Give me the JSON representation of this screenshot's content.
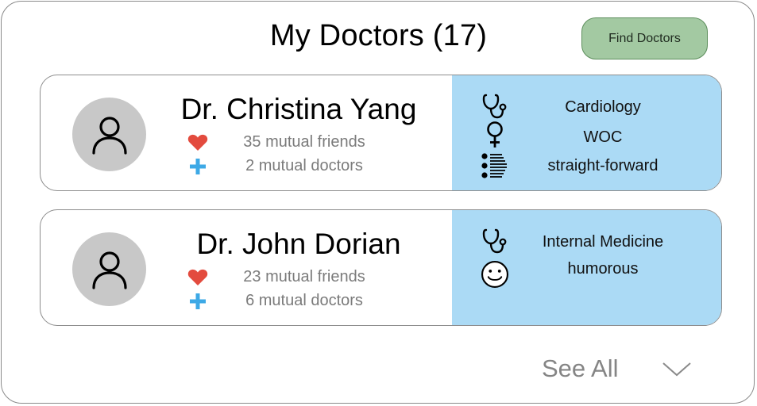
{
  "header": {
    "title": "My Doctors (17)",
    "find_button_label": "Find Doctors"
  },
  "doctors": [
    {
      "name": "Dr. Christina Yang",
      "mutual_friends": "35 mutual friends",
      "mutual_doctors": "2 mutual doctors",
      "attributes": [
        {
          "icon": "stethoscope-icon",
          "label": "Cardiology"
        },
        {
          "icon": "female-symbol-icon",
          "label": "WOC"
        },
        {
          "icon": "list-icon",
          "label": "straight-forward"
        }
      ]
    },
    {
      "name": "Dr. John Dorian",
      "mutual_friends": "23 mutual friends",
      "mutual_doctors": "6 mutual doctors",
      "attributes": [
        {
          "icon": "stethoscope-icon",
          "label": "Internal Medicine"
        },
        {
          "icon": "smiley-face-icon",
          "label": "humorous"
        }
      ]
    }
  ],
  "footer": {
    "see_all_label": "See All"
  },
  "colors": {
    "find_button_bg": "#a3c9a2",
    "card_right_bg": "#abdaf5",
    "heart": "#e34b3e",
    "plus": "#3da9e6",
    "avatar_bg": "#c8c8c8"
  }
}
